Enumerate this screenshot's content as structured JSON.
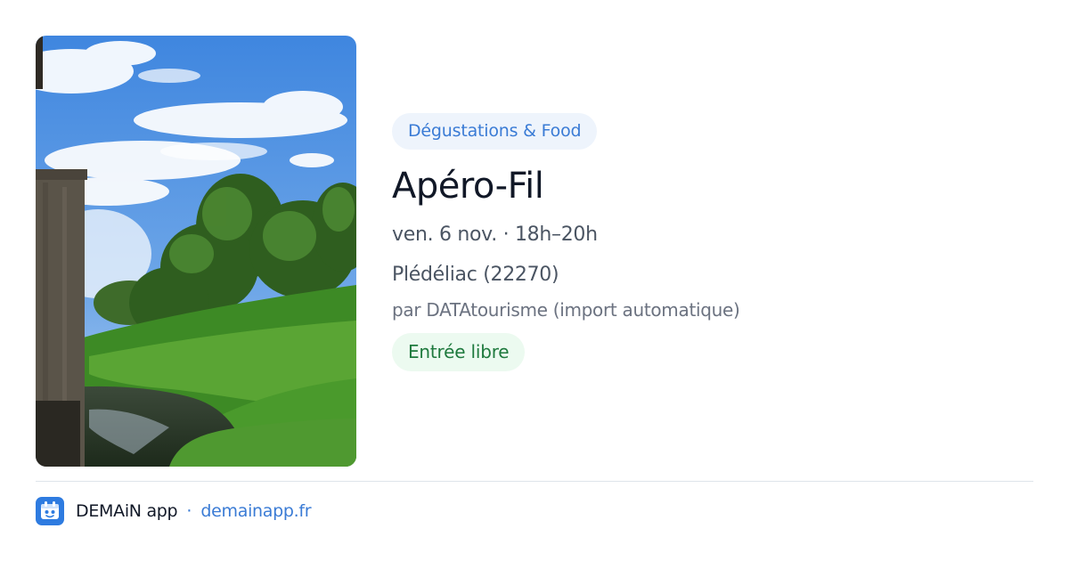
{
  "event": {
    "category": "Dégustations & Food",
    "title": "Apéro-Fil",
    "datetime": "ven. 6 nov. · 18h–20h",
    "location": "Plédéliac (22270)",
    "organizer": "par DATAtourisme (import automatique)",
    "price": "Entrée libre"
  },
  "photo": {
    "subject": "castle moat with trees under a blue sky"
  },
  "footer": {
    "icon": "app-logo-icon",
    "app_name": "DEMAiN app",
    "separator": "·",
    "url": "demainapp.fr"
  },
  "colors": {
    "accent": "#3a7bd5",
    "category_bg": "#eef4fc",
    "price_text": "#1f7a3e",
    "price_bg": "#ecfaf0",
    "divider": "#dfe5ea",
    "app_icon_bg": "#2e7be0"
  }
}
